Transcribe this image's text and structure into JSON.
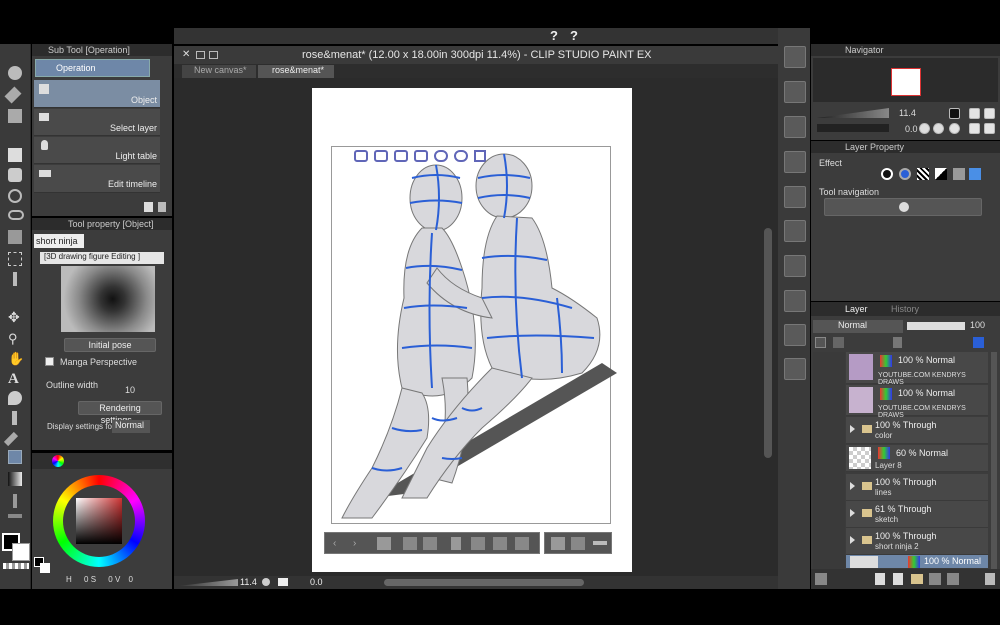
{
  "window": {
    "title": "rose&menat* (12.00 x 18.00in 300dpi 11.4%)  - CLIP STUDIO PAINT EX"
  },
  "tabs": [
    {
      "label": "New canvas*"
    },
    {
      "label": "rose&menat*"
    }
  ],
  "subtool": {
    "title": "Sub Tool [Operation]",
    "group": "Operation",
    "items": [
      "Object",
      "Select layer",
      "Light table",
      "Edit timeline"
    ]
  },
  "tool_property": {
    "title": "Tool property [Object]",
    "preset": "short ninja",
    "mode": "[3D drawing figure Editing ]",
    "initial_pose_label": "Initial pose",
    "manga_perspective_label": "Manga Perspective",
    "outline_width_label": "Outline width",
    "outline_width_value": "10",
    "rendering_button": "Rendering settings...",
    "display_settings_label": "Display settings for",
    "display_settings_value": "Normal"
  },
  "color": {
    "hsv": {
      "h_label": "H",
      "h": "0",
      "s_label": "S",
      "s": "0",
      "v_label": "V",
      "v": "0"
    }
  },
  "status": {
    "zoom": "11.4",
    "rotation": "0.0"
  },
  "navigator": {
    "title": "Navigator",
    "zoom": "11.4",
    "rotation": "0.0"
  },
  "layer_property": {
    "title": "Layer Property",
    "effect_label": "Effect",
    "tool_navigation_label": "Tool navigation"
  },
  "layer_panel": {
    "tab_layer": "Layer",
    "tab_history": "History",
    "blend_mode": "Normal",
    "opacity": "100",
    "layers": [
      {
        "line1": "100 % Normal",
        "line2": "YOUTUBE.COM KENDRYS DRAWS",
        "kind": "image"
      },
      {
        "line1": "100 % Normal",
        "line2": "YOUTUBE.COM KENDRYS DRAWS",
        "kind": "image"
      },
      {
        "line1": "100 % Through",
        "line2": "color",
        "kind": "folder"
      },
      {
        "line1": "60 % Normal",
        "line2": "Layer 8",
        "kind": "raster"
      },
      {
        "line1": "100 % Through",
        "line2": "lines",
        "kind": "folder"
      },
      {
        "line1": "61 % Through",
        "line2": "sketch",
        "kind": "folder"
      },
      {
        "line1": "100 % Through",
        "line2": "short ninja 2",
        "kind": "folder"
      },
      {
        "line1": "100 % Normal",
        "line2": "",
        "kind": "selected"
      }
    ]
  },
  "colors": {
    "accent_blue": "#2a5fd6",
    "panel_bg": "#3c3c3c",
    "canvas_bg": "#2b2b2b",
    "selected_row": "#6e87a8"
  }
}
